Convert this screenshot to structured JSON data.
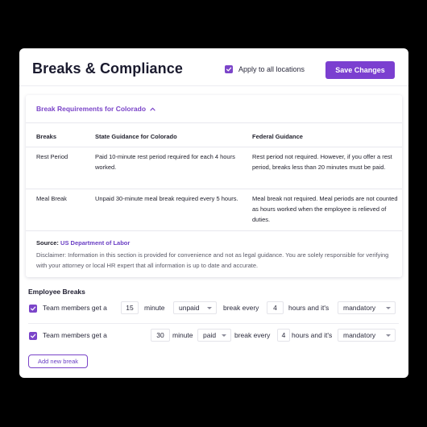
{
  "header": {
    "title": "Breaks & Compliance",
    "apply_label": "Apply to all locations",
    "apply_checked": true,
    "save_label": "Save Changes"
  },
  "requirements": {
    "title": "Break Requirements for Colorado",
    "columns": [
      "Breaks",
      "State Guidance for Colorado",
      "Federal Guidance"
    ],
    "rows": [
      {
        "break": "Rest Period",
        "state": "Paid 10-minute rest period required for each 4 hours worked.",
        "federal": "Rest period not required. However, if you offer a rest period, breaks less than 20 minutes must be paid."
      },
      {
        "break": "Meal Break",
        "state": "Unpaid 30-minute meal break required every 5 hours.",
        "federal": "Meal break not required. Meal periods are not counted as hours worked when the employee is relieved of duties."
      }
    ],
    "source_label": "Source:",
    "source_link": "US Department of Labor",
    "disclaimer": "Disclaimer: Information in this section is provided for convenience and not as legal guidance. You are solely responsible for verifying with your attorney or local HR expert that all information is up to date and accurate."
  },
  "employee_breaks": {
    "title": "Employee Breaks",
    "text_get": "Team members get a",
    "text_minute": "minute",
    "text_break_every": "break every",
    "text_hours": "hours and it's",
    "rows": [
      {
        "checked": true,
        "minutes": "15",
        "pay": "unpaid",
        "hours": "4",
        "requirement": "mandatory"
      },
      {
        "checked": true,
        "minutes": "30",
        "pay": "paid",
        "hours": "4",
        "requirement": "mandatory"
      }
    ],
    "add_label": "Add new break"
  },
  "colors": {
    "accent": "#7b3fd0",
    "background": "#000000",
    "card": "#ffffff"
  },
  "icons": {
    "checkbox": "check-icon",
    "collapse": "chevron-up-icon",
    "dropdown": "caret-down-icon"
  }
}
